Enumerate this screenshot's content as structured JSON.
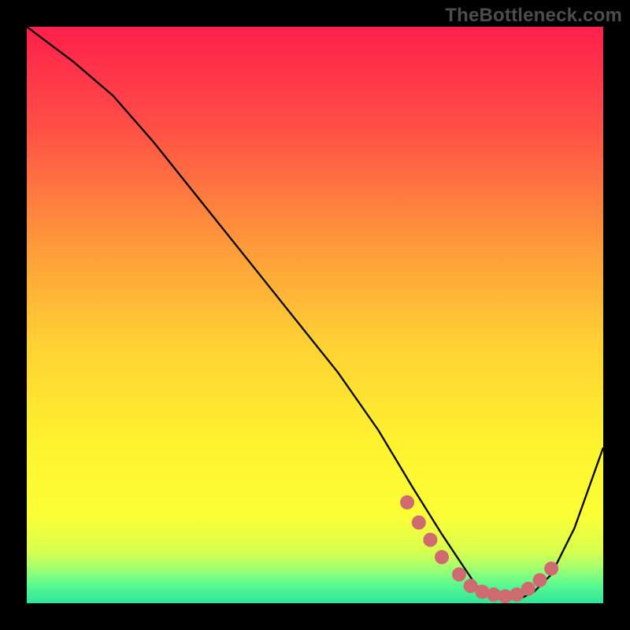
{
  "watermark": "TheBottleneck.com",
  "chart_data": {
    "type": "line",
    "title": "",
    "xlabel": "",
    "ylabel": "",
    "xlim": [
      0,
      100
    ],
    "ylim": [
      0,
      100
    ],
    "grid": false,
    "series": [
      {
        "name": "curve",
        "x": [
          0,
          8,
          15,
          22,
          30,
          38,
          46,
          54,
          61,
          67,
          72,
          76,
          78,
          80,
          82,
          84,
          86,
          88,
          91,
          95,
          100
        ],
        "y": [
          100,
          94,
          88,
          80,
          70,
          60,
          50,
          40,
          30,
          20,
          12,
          6,
          3,
          2,
          1,
          1,
          1,
          2,
          5,
          13,
          27
        ]
      }
    ],
    "markers": [
      {
        "x": 66,
        "y": 17.5
      },
      {
        "x": 68,
        "y": 14
      },
      {
        "x": 70,
        "y": 11
      },
      {
        "x": 72,
        "y": 8
      },
      {
        "x": 75,
        "y": 5
      },
      {
        "x": 77,
        "y": 3
      },
      {
        "x": 79,
        "y": 2
      },
      {
        "x": 81,
        "y": 1.5
      },
      {
        "x": 83,
        "y": 1.2
      },
      {
        "x": 85,
        "y": 1.5
      },
      {
        "x": 87,
        "y": 2.5
      },
      {
        "x": 89,
        "y": 4
      },
      {
        "x": 91,
        "y": 6
      }
    ],
    "gradient_stops": [
      {
        "offset": 0,
        "color": "#ff1f4b"
      },
      {
        "offset": 18,
        "color": "#ff5146"
      },
      {
        "offset": 38,
        "color": "#ff9a3a"
      },
      {
        "offset": 55,
        "color": "#ffd133"
      },
      {
        "offset": 72,
        "color": "#fff22f"
      },
      {
        "offset": 85,
        "color": "#fbff35"
      },
      {
        "offset": 91,
        "color": "#d8ff4e"
      },
      {
        "offset": 93,
        "color": "#b4ff65"
      },
      {
        "offset": 95,
        "color": "#88ff7c"
      },
      {
        "offset": 97,
        "color": "#57f890"
      },
      {
        "offset": 100,
        "color": "#2fe49a"
      }
    ],
    "marker_color": "#cf6b70",
    "curve_color": "#000000"
  }
}
